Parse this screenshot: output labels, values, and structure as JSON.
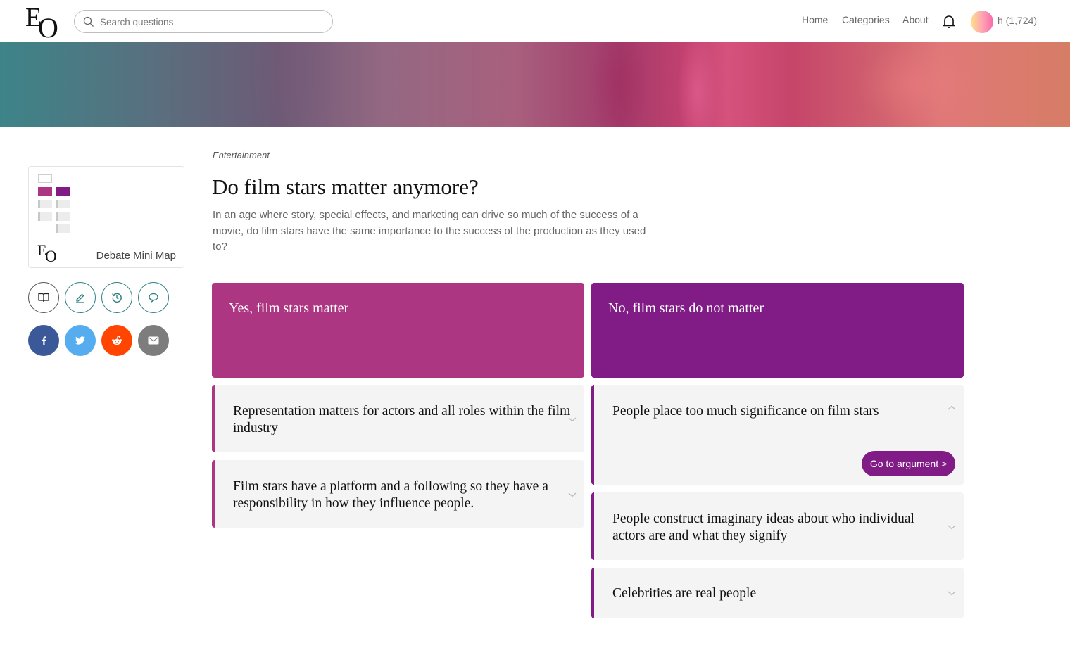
{
  "header": {
    "logo": {
      "e": "E",
      "o": "O"
    },
    "search": {
      "placeholder": "Search questions",
      "value": ""
    },
    "nav": [
      {
        "label": "Home"
      },
      {
        "label": "Categories"
      },
      {
        "label": "About"
      }
    ],
    "user": {
      "label": "h (1,724)"
    },
    "icons": {
      "search": "search-icon",
      "notifications": "bell-icon"
    }
  },
  "sidebar": {
    "minimap": {
      "label": "Debate Mini Map"
    },
    "tools": [
      {
        "name": "read",
        "icon": "book-icon"
      },
      {
        "name": "edit",
        "icon": "pencil-icon"
      },
      {
        "name": "history",
        "icon": "history-icon"
      },
      {
        "name": "comments",
        "icon": "speech-bubble-icon"
      }
    ],
    "share": [
      {
        "name": "facebook",
        "icon": "facebook-icon",
        "color": "#3b5998"
      },
      {
        "name": "twitter",
        "icon": "twitter-icon",
        "color": "#55acee"
      },
      {
        "name": "reddit",
        "icon": "reddit-icon",
        "color": "#ff4500"
      },
      {
        "name": "email",
        "icon": "email-icon",
        "color": "#7d7d7d"
      }
    ]
  },
  "question": {
    "category": "Entertainment",
    "title": "Do film stars matter anymore?",
    "description": "In an age where story, special effects, and marketing can drive so much of the success of a movie, do film stars have the same importance to the success of the production as they used to?"
  },
  "colors": {
    "yes": "#ad3682",
    "no": "#811c86",
    "card_bg": "#f4f4f4"
  },
  "sides": [
    {
      "key": "yes",
      "title": "Yes, film stars matter",
      "arguments": [
        {
          "text": "Representation matters for actors and all roles within the film industry",
          "expanded": false
        },
        {
          "text": "Film stars have a platform and a following so they have a responsibility in how they influence people.",
          "expanded": false
        }
      ]
    },
    {
      "key": "no",
      "title": "No, film stars do not matter",
      "arguments": [
        {
          "text": "People place too much significance on film stars",
          "expanded": true,
          "button": "Go to argument >"
        },
        {
          "text": "People construct imaginary ideas about who individual actors are and what they signify",
          "expanded": false
        },
        {
          "text": "Celebrities are real people",
          "expanded": false
        }
      ]
    }
  ]
}
